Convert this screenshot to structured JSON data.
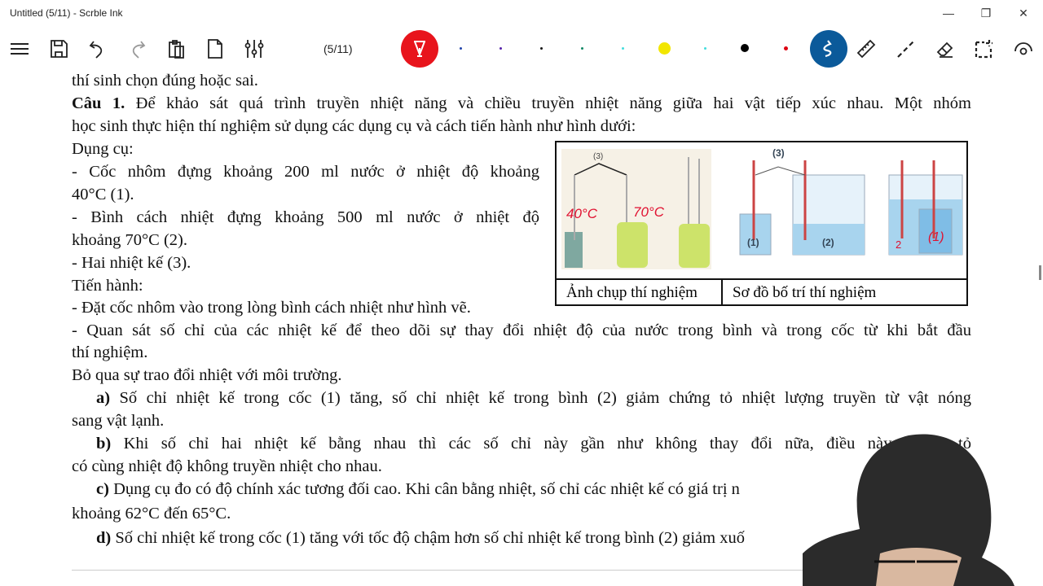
{
  "window": {
    "title": "Untitled (5/11) - Scrble Ink",
    "minimize": "—",
    "restore": "❐",
    "close": "✕"
  },
  "toolbar": {
    "page_indicator": "(5/11)",
    "pen_colors": [
      "#2244aa",
      "#5522aa",
      "#111111",
      "#118866",
      "#44dddd",
      "#f2e600",
      "#44dddd",
      "#000000",
      "#dd0011"
    ],
    "accent_red": "#e8141c",
    "accent_blue": "#0b5a9a"
  },
  "document": {
    "lines": [
      "thí sinh chọn đúng hoặc sai.",
      "Để khảo sát quá trình truyền nhiệt năng và chiều truyền nhiệt năng giữa hai vật tiếp xúc nhau. Một nhóm",
      "học sinh thực hiện thí nghiệm sử dụng các dụng cụ và cách tiến hành như hình dưới:",
      "Dụng cụ:",
      "- Cốc nhôm đựng khoảng 200 ml nước ở nhiệt độ khoảng",
      "40°C (1).",
      "- Bình cách nhiệt đựng khoảng 500 ml nước ở nhiệt độ",
      "khoảng 70°C (2).",
      "- Hai nhiệt kế (3).",
      "Tiến hành:",
      "- Đặt cốc nhôm vào trong lòng bình cách nhiệt như hình vẽ.",
      "- Quan sát số chỉ của các nhiệt kế để theo dõi sự thay đổi nhiệt độ của nước trong bình và trong cốc từ khi bắt đầu",
      "thí nghiệm.",
      "Bỏ qua sự trao đổi nhiệt với môi trường.",
      "Số chỉ nhiệt kế trong cốc (1) tăng, số chỉ nhiệt kế trong bình (2) giảm chứng tỏ nhiệt lượng truyền từ vật nóng",
      "sang vật lạnh.",
      "Khi số chỉ hai nhiệt kế bằng nhau thì các số chỉ này gần như không thay đổi nữa, điều này chứng tỏ",
      "có cùng nhiệt độ không truyền nhiệt cho nhau.",
      "Dụng cụ đo có độ chính xác tương đối cao. Khi cân bằng nhiệt, số chỉ các nhiệt kế có giá trị n",
      "khoảng 62°C đến 65°C.",
      "Số chỉ nhiệt kế trong cốc (1) tăng với tốc độ chậm hơn số chỉ nhiệt kế trong bình (2) giảm xuố"
    ],
    "question_label": "Câu 1.",
    "option_labels": [
      "a)",
      "b)",
      "c)",
      "d)"
    ],
    "figure": {
      "caption_left": "Ảnh chụp thí nghiệm",
      "caption_right": "Sơ đồ bố trí thí nghiệm",
      "labels": {
        "thermometers": "(3)",
        "cup": "(1)",
        "vessel": "(2)"
      },
      "handwriting": {
        "t1": "40°C",
        "t2": "70°C",
        "n2": "2",
        "n1": "(1)"
      }
    }
  }
}
